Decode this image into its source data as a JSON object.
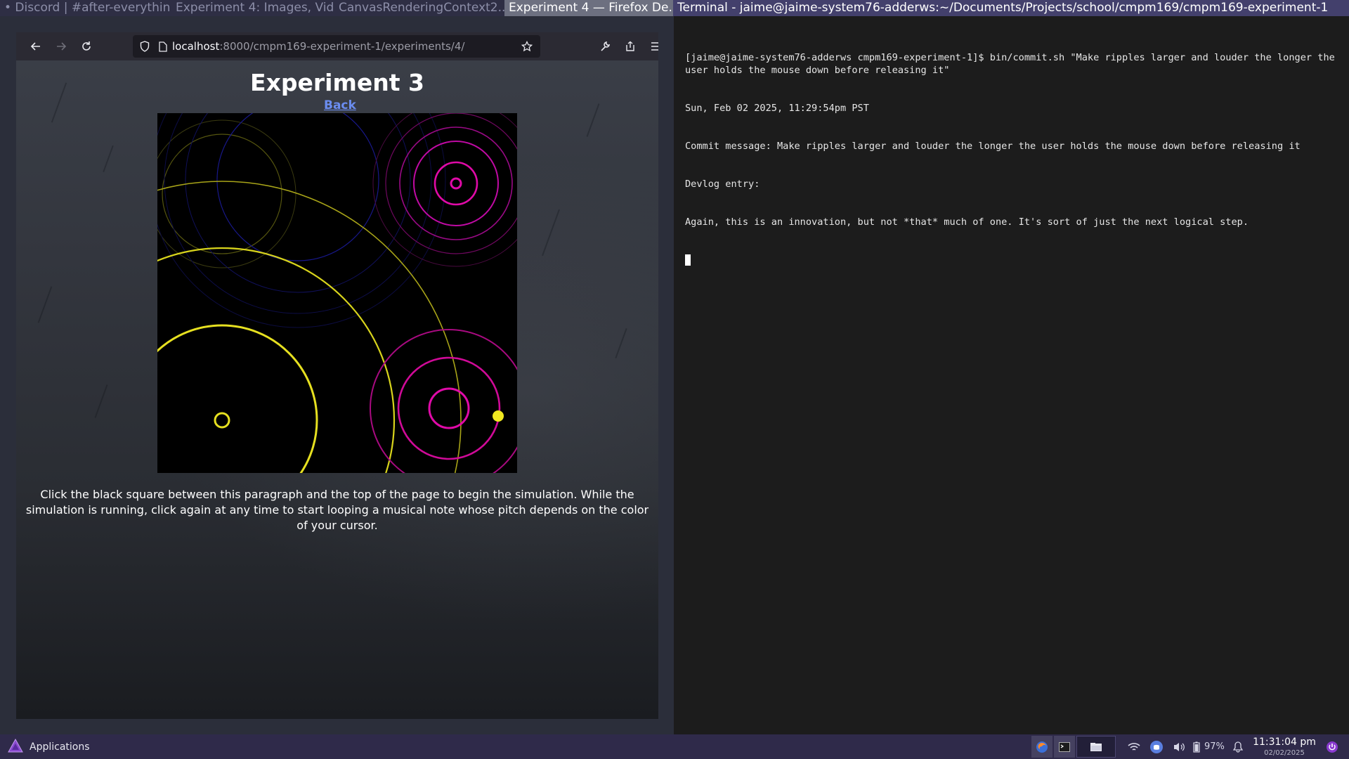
{
  "topbar": {
    "windows": [
      "• Discord | #after-everythin...",
      "Experiment 4: Images, Vid...",
      "CanvasRenderingContext2...",
      "Experiment 4 — Firefox De...",
      "Terminal - jaime@jaime-system76-adderws:~/Documents/Projects/school/cmpm169/cmpm169-experiment-1"
    ]
  },
  "browser": {
    "url_host": "localhost",
    "url_path": ":8000/cmpm169-experiment-1/experiments/4/",
    "icons": [
      "back-arrow-icon",
      "forward-arrow-icon",
      "reload-icon",
      "shield-icon",
      "page-icon",
      "star-icon",
      "wrench-icon",
      "share-icon",
      "hamburger-menu-icon"
    ]
  },
  "page": {
    "title": "Experiment 3",
    "back_link": "Back",
    "instructions": "Click the black square between this paragraph and the top of the page to begin the simulation. While the simulation is running, click again at any time to start looping a musical note whose pitch depends on the color of your cursor.",
    "colors": {
      "yellow": "#e6e020",
      "magenta": "#e00aa8",
      "blue": "#2030c0",
      "link": "#6b8df0"
    }
  },
  "terminal": {
    "lines": [
      "[jaime@jaime-system76-adderws cmpm169-experiment-1]$ bin/commit.sh \"Make ripples larger and louder the longer the user holds the mouse down before releasing it\"",
      "Sun, Feb 02 2025, 11:29:54pm PST",
      "Commit message: Make ripples larger and louder the longer the user holds the mouse down before releasing it",
      "Devlog entry:",
      "Again, this is an innovation, but not *that* much of one. It's sort of just the next logical step."
    ]
  },
  "panel": {
    "applications": "Applications",
    "battery": "97%",
    "time": "11:31:04 pm",
    "date": "02/02/2025"
  }
}
